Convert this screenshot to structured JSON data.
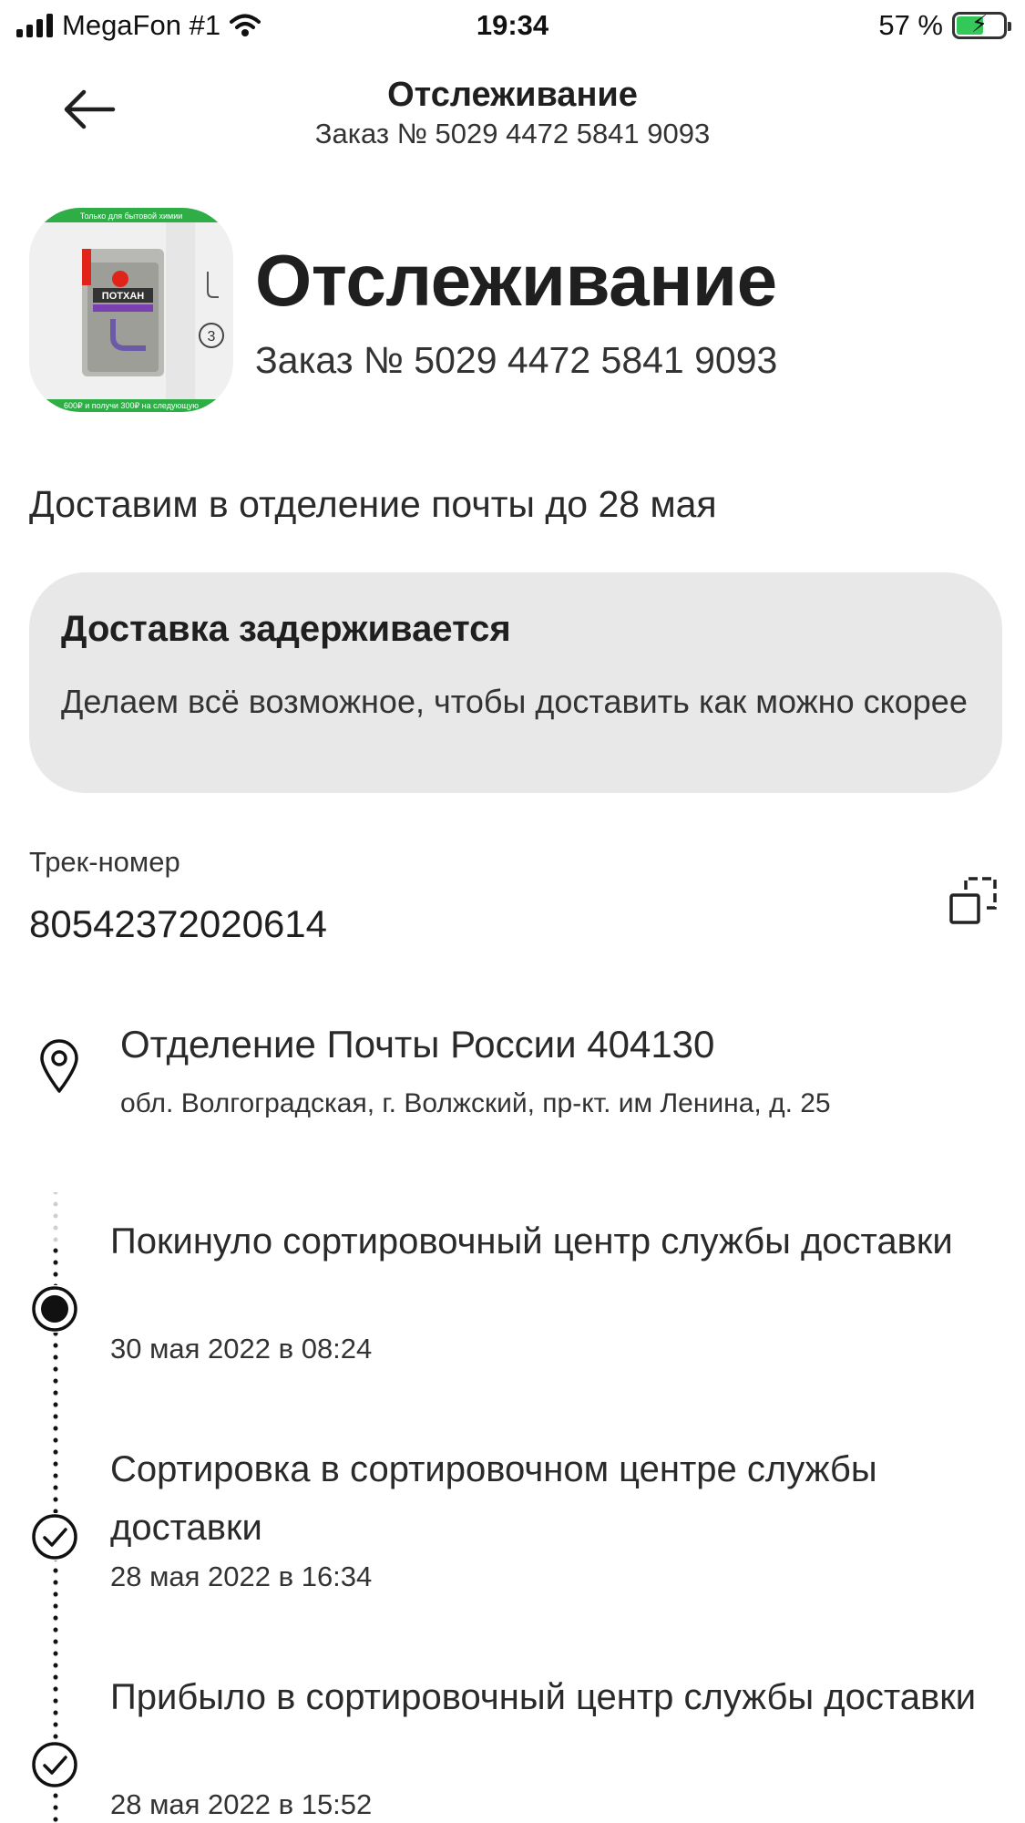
{
  "status_bar": {
    "carrier": "MegaFon #1",
    "time": "19:34",
    "battery_percent": "57 %",
    "battery_level": 0.57
  },
  "nav": {
    "title": "Отслеживание",
    "subtitle": "Заказ № 5029 4472 5841 9093",
    "back_icon": "arrow-left-icon"
  },
  "header": {
    "product_image": {
      "banner_top": "Только для бытовой химии",
      "brand_name": "ПОТХАН",
      "banner_bottom": "600₽ и получи 300₽ на следующую"
    },
    "title": "Отслеживание",
    "order_number": "Заказ № 5029 4472 5841 9093"
  },
  "delivery_estimate": "Доставим в отделение почты до 28 мая",
  "alert": {
    "title": "Доставка задерживается",
    "text": "Делаем всё возможное, чтобы доставить как можно скорее",
    "background": "#e8e8e8"
  },
  "tracking": {
    "label": "Трек-номер",
    "number": "80542372020614",
    "copy_icon": "copy-icon"
  },
  "pickup": {
    "icon": "location-pin-icon",
    "name": "Отделение Почты России 404130",
    "address": "обл. Волгоградская, г. Волжский, пр-кт. им Ленина, д. 25"
  },
  "events": [
    {
      "title": "Покинуло сортировочный центр службы доставки",
      "date": "30 мая 2022 в 08:24",
      "icon": "current-dot-icon"
    },
    {
      "title": "Сортировка в сортировочном центре службы доставки",
      "date": "28 мая 2022 в 16:34",
      "icon": "check-circle-icon"
    },
    {
      "title": "Прибыло в сортировочный центр службы доставки",
      "date": "28 мая 2022 в 15:52",
      "icon": "check-circle-icon"
    }
  ]
}
